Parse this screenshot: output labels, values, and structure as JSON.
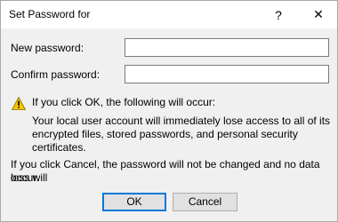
{
  "window": {
    "title": "Set Password for",
    "help_glyph": "?",
    "close_glyph": "✕"
  },
  "form": {
    "new_password_label": "New password:",
    "new_password_value": "",
    "confirm_password_label": "Confirm password:",
    "confirm_password_value": ""
  },
  "warning": {
    "icon": "warning-triangle-icon",
    "heading": "If you click OK, the following will occur:",
    "line1": "Your local user account will immediately lose access to all of its",
    "line2": "encrypted files, stored passwords, and personal security certificates."
  },
  "cancel_note": {
    "line1": "If you click Cancel, the password will not be changed and no data loss will",
    "line2": "occur."
  },
  "buttons": {
    "ok_label": "OK",
    "cancel_label": "Cancel"
  },
  "colors": {
    "accent": "#0078d7",
    "warning_yellow": "#f7c600"
  }
}
